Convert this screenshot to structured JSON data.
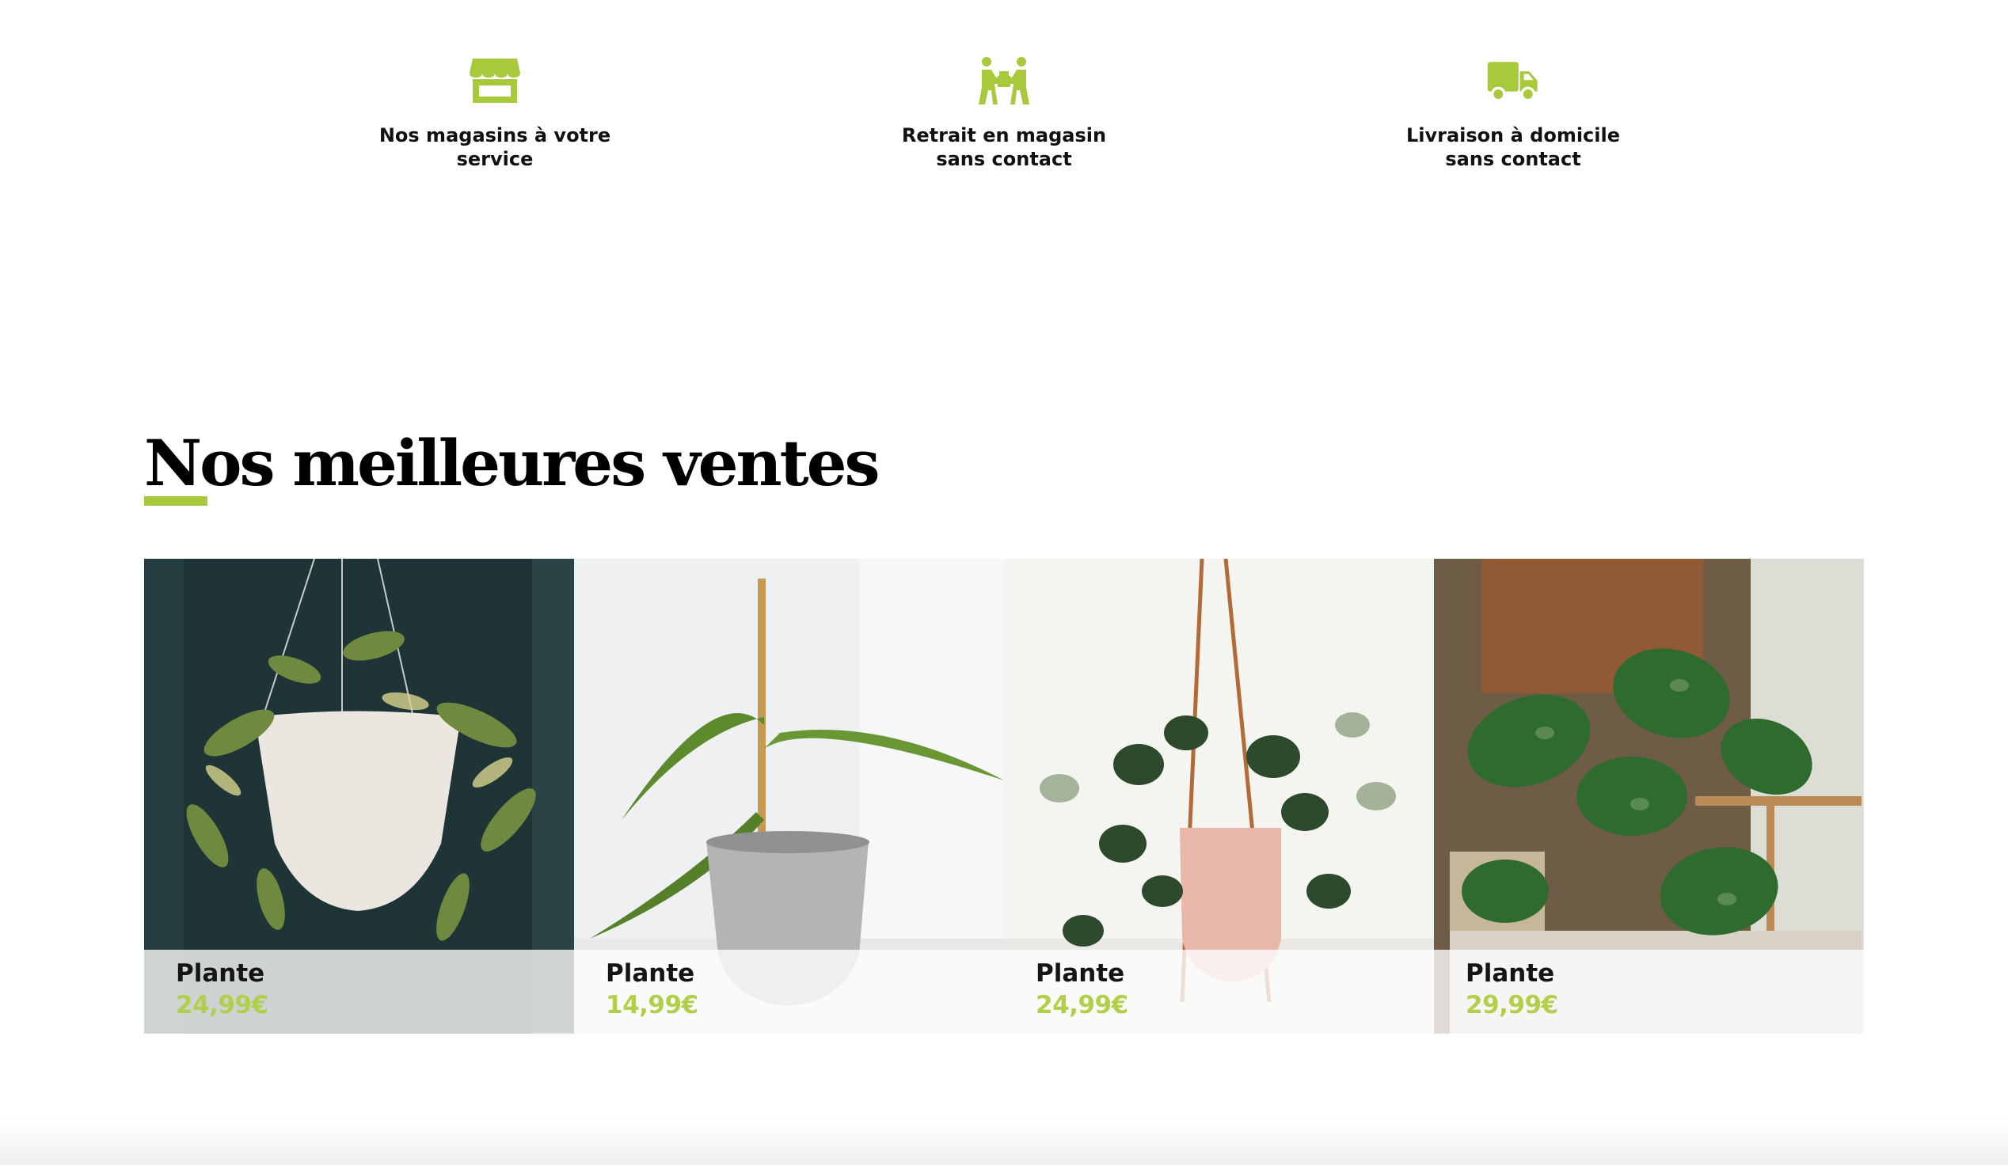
{
  "accent_color": "#a9c93c",
  "services": [
    {
      "icon": "store-icon",
      "line1": "Nos magasins à votre",
      "line2": "service"
    },
    {
      "icon": "handover-icon",
      "line1": "Retrait en magasin",
      "line2": "sans contact"
    },
    {
      "icon": "delivery-truck-icon",
      "line1": "Livraison à domicile",
      "line2": "sans contact"
    }
  ],
  "bestsellers": {
    "title": "Nos meilleures ventes",
    "products": [
      {
        "name": "Plante",
        "price": "24,99€",
        "image": "hoya-hanging-white-pot"
      },
      {
        "name": "Plante",
        "price": "14,99€",
        "image": "vanilla-orchid-concrete-pot"
      },
      {
        "name": "Plante",
        "price": "24,99€",
        "image": "scindapsus-hanging-pink-pot"
      },
      {
        "name": "Plante",
        "price": "29,99€",
        "image": "monstera-adansonii-shelf"
      }
    ]
  }
}
